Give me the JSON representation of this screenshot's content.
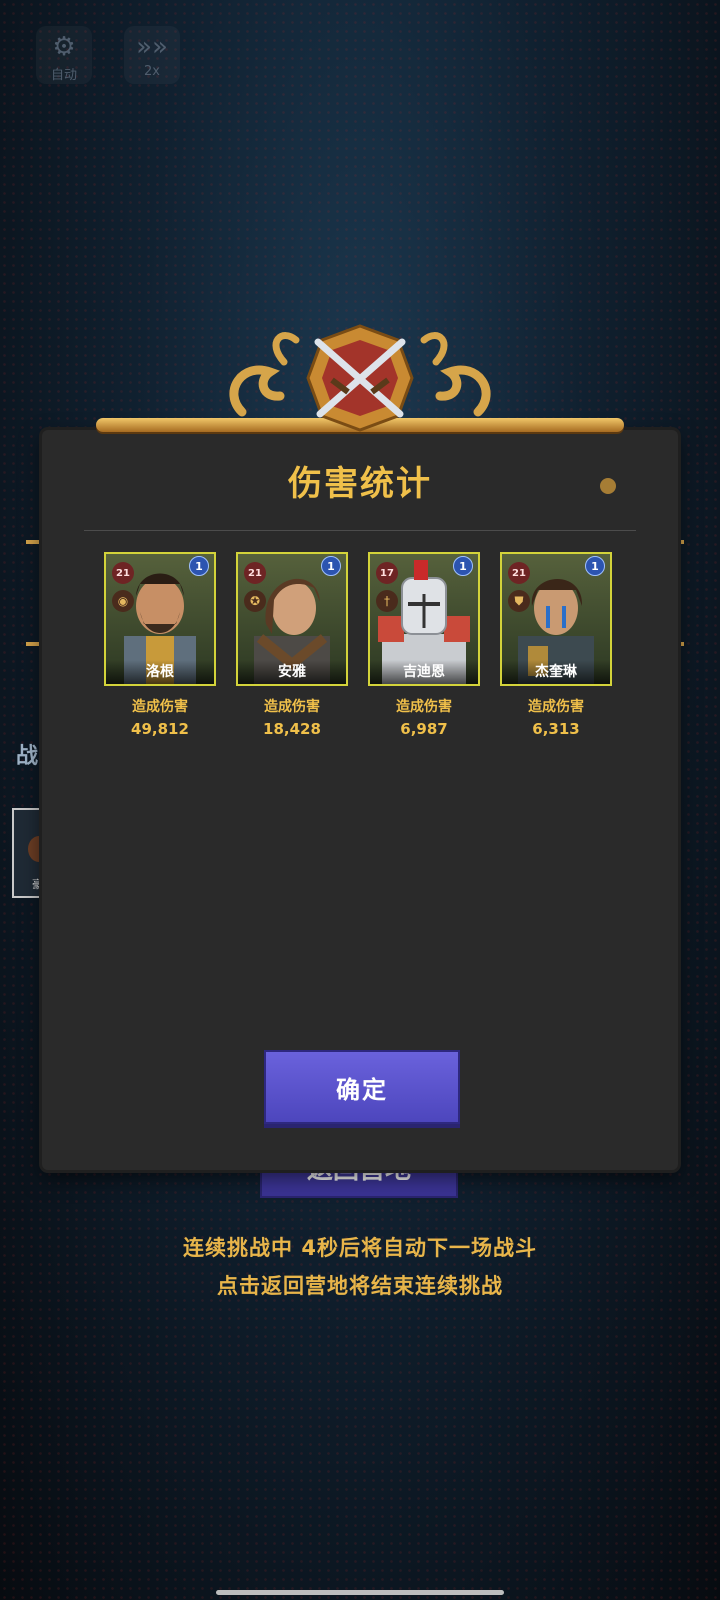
{
  "controls": {
    "auto_label": "自动",
    "speed_label": "2x"
  },
  "background": {
    "left_tab_text": "战斗",
    "left_card_caption": "豪",
    "return_camp_label": "返回营地"
  },
  "dialog": {
    "title": "伤害统计",
    "confirm_label": "确定",
    "heroes": [
      {
        "name": "洛根",
        "level": "21",
        "stars": "1",
        "damage_label": "造成伤害",
        "damage": "49,812",
        "class_icon": "eye-icon"
      },
      {
        "name": "安雅",
        "level": "21",
        "stars": "1",
        "damage_label": "造成伤害",
        "damage": "18,428",
        "class_icon": "pentagram-icon"
      },
      {
        "name": "吉迪恩",
        "level": "17",
        "stars": "1",
        "damage_label": "造成伤害",
        "damage": "6,987",
        "class_icon": "sword-icon"
      },
      {
        "name": "杰奎琳",
        "level": "21",
        "stars": "1",
        "damage_label": "造成伤害",
        "damage": "6,313",
        "class_icon": "shield-icon"
      }
    ]
  },
  "info": {
    "line1": "连续挑战中 4秒后将自动下一场战斗",
    "line2": "点击返回营地将结束连续挑战"
  },
  "colors": {
    "accent_gold": "#f0c04a",
    "button_purple": "#5a52cc",
    "portrait_border": "#d3d33a"
  }
}
